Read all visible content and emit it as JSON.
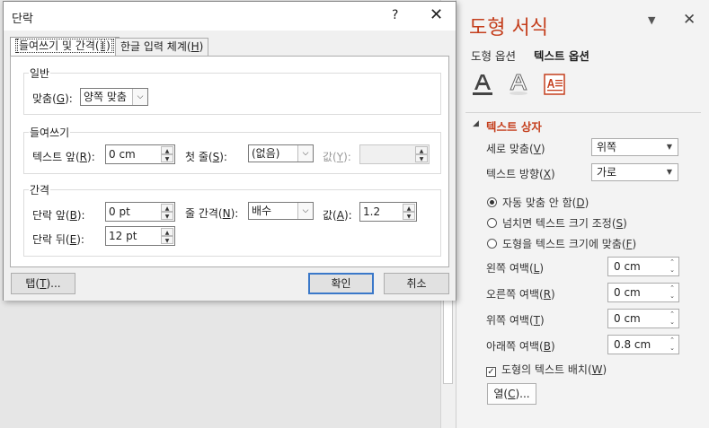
{
  "pane": {
    "title": "도형 서식",
    "menu_caret": "▼",
    "close": "✕",
    "tabs": [
      "도형 옵션",
      "텍스트 옵션"
    ],
    "section_arrow": "◢",
    "section_title": "텍스트 상자",
    "vertical_align": {
      "label_pre": "세로 맞춤(",
      "label_key": "V",
      "label_post": ")",
      "value": "위쪽"
    },
    "text_direction": {
      "label_pre": "텍스트 방향(",
      "label_key": "X",
      "label_post": ")",
      "value": "가로"
    },
    "autofit": [
      {
        "text_pre": "자동 맞춤 안 함(",
        "key": "D",
        "text_post": ")",
        "selected": true
      },
      {
        "text_pre": "넘치면 텍스트 크기 조정(",
        "key": "S",
        "text_post": ")",
        "selected": false
      },
      {
        "text_pre": "도형을 텍스트 크기에 맞춤(",
        "key": "F",
        "text_post": ")",
        "selected": false
      }
    ],
    "margins": [
      {
        "label_pre": "왼쪽 여백(",
        "key": "L",
        "label_post": ")",
        "value": "0 cm"
      },
      {
        "label_pre": "오른쪽 여백(",
        "key": "R",
        "label_post": ")",
        "value": "0 cm"
      },
      {
        "label_pre": "위쪽 여백(",
        "key": "T",
        "label_post": ")",
        "value": "0 cm"
      },
      {
        "label_pre": "아래쪽 여백(",
        "key": "B",
        "label_post": ")",
        "value": "0.8 cm"
      }
    ],
    "wrap": {
      "text_pre": "도형의 텍스트 배치(",
      "key": "W",
      "text_post": ")",
      "checked": true,
      "check_mark": "✓"
    },
    "columns_button": {
      "pre": "열(",
      "key": "C",
      "post": ")..."
    }
  },
  "dialog": {
    "title": "단락",
    "help": "?",
    "close": "✕",
    "tabs": [
      {
        "pre": "들여쓰기 및 간격(",
        "key": "I",
        "post": ")"
      },
      {
        "pre": "한글 입력 체계(",
        "key": "H",
        "post": ")"
      }
    ],
    "general": {
      "title": "일반",
      "alignment": {
        "label_pre": "맞춤(",
        "key": "G",
        "label_post": "):",
        "value": "양쪽 맞춤"
      }
    },
    "indent": {
      "title": "들여쓰기",
      "before_text": {
        "label_pre": "텍스트 앞(",
        "key": "R",
        "label_post": "):",
        "value": "0 cm"
      },
      "first_line": {
        "label_pre": "첫 줄(",
        "key": "S",
        "label_post": "):",
        "value": "(없음)"
      },
      "by": {
        "label_pre": "값(",
        "key": "Y",
        "label_post": "):",
        "value": ""
      }
    },
    "spacing": {
      "title": "간격",
      "before": {
        "label_pre": "단락 앞(",
        "key": "B",
        "label_post": "):",
        "value": "0 pt"
      },
      "line_spacing": {
        "label_pre": "줄 간격(",
        "key": "N",
        "label_post": "):",
        "value": "배수"
      },
      "at": {
        "label_pre": "값(",
        "key": "A",
        "label_post": "):",
        "value": "1.2"
      },
      "after": {
        "label_pre": "단락 뒤(",
        "key": "E",
        "label_post": "):",
        "value": "12 pt"
      }
    },
    "buttons": {
      "tabs": {
        "pre": "탭(",
        "key": "T",
        "post": ")..."
      },
      "ok": "확인",
      "cancel": "취소"
    },
    "spin_up": "▲",
    "spin_down": "▼",
    "dd_caret": "⌵"
  },
  "colors": {
    "accent": "#c43e1c",
    "focus": "#3a78c9"
  }
}
